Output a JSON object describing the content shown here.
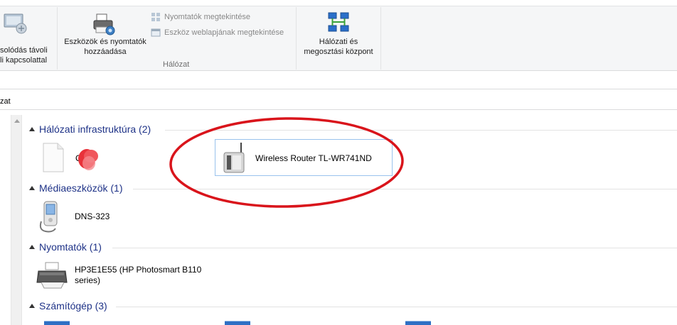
{
  "ribbon": {
    "remote_label_line1": "solódás távoli",
    "remote_label_line2": "li kapcsolattal",
    "add_devices_line1": "Eszközök és nyomtatók",
    "add_devices_line2": "hozzáadása",
    "view_printers": "Nyomtatók megtekintése",
    "view_device_web": "Eszköz weblapjának megtekintése",
    "group_network": "Hálózat",
    "network_center_line1": "Hálózati és",
    "network_center_line2": "megosztási központ"
  },
  "address": {
    "text": "zat"
  },
  "groups": [
    {
      "title": "Hálózati infrastruktúra (2)",
      "items": [
        {
          "label": "O"
        },
        {
          "label": "Wireless Router TL-WR741ND"
        }
      ]
    },
    {
      "title": "Médiaeszközök (1)",
      "items": [
        {
          "label": "DNS-323"
        }
      ]
    },
    {
      "title": "Nyomtatók (1)",
      "items": [
        {
          "label_line1": "HP3E1E55 (HP Photosmart B110",
          "label_line2": "series)"
        }
      ]
    },
    {
      "title": "Számítógép (3)",
      "items": []
    }
  ],
  "colors": {
    "group_title": "#1e3287",
    "annotation_ellipse": "#d9141b",
    "selection_border": "#99c2ed"
  }
}
